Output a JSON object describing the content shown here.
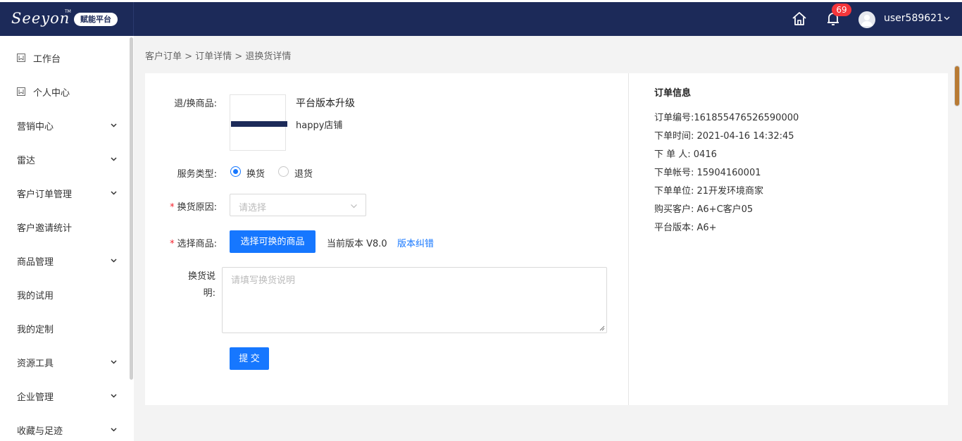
{
  "header": {
    "logo": "Seeyon",
    "logo_tm": "TM",
    "platform_badge": "赋能平台",
    "notification_count": "69",
    "username": "user589621",
    "icons": [
      "home-icon",
      "bell-icon",
      "avatar",
      "chevron-down-icon"
    ],
    "colors": {
      "topbar": "#1c2a59",
      "badge": "#f5363b",
      "primary": "#1677ff"
    }
  },
  "sidebar": {
    "items": [
      {
        "label": "工作台",
        "icon": "bookmark-icon",
        "has_children": false
      },
      {
        "label": "个人中心",
        "icon": "bookmark-icon",
        "has_children": false
      },
      {
        "label": "营销中心",
        "has_children": true
      },
      {
        "label": "雷达",
        "has_children": true
      },
      {
        "label": "客户订单管理",
        "has_children": true
      },
      {
        "label": "客户邀请统计",
        "has_children": false
      },
      {
        "label": "商品管理",
        "has_children": true
      },
      {
        "label": "我的试用",
        "has_children": false
      },
      {
        "label": "我的定制",
        "has_children": false
      },
      {
        "label": "资源工具",
        "has_children": true
      },
      {
        "label": "企业管理",
        "has_children": true
      },
      {
        "label": "收藏与足迹",
        "has_children": true
      }
    ]
  },
  "breadcrumb": "客户订单 > 订单详情 > 退换货详情",
  "form": {
    "product_label": "退/换商品:",
    "product_name": "平台版本升级",
    "product_shop": "happy店铺",
    "service_type_label": "服务类型:",
    "service_options": [
      "换货",
      "退货"
    ],
    "service_selected": "换货",
    "reason_label": "换货原因:",
    "reason_placeholder": "请选择",
    "select_product_label": "选择商品:",
    "select_product_button": "选择可换的商品",
    "current_version": "当前版本 V8.0",
    "version_fix_link": "版本纠错",
    "desc_label_line1": "换货说",
    "desc_label_line2": "明:",
    "desc_placeholder": "请填写换货说明",
    "submit_button": "提 交",
    "required_mark": "*"
  },
  "order_info": {
    "title": "订单信息",
    "rows": [
      "订单编号:161855476526590000",
      "下单时间:  2021-04-16 14:32:45",
      "下 单 人:  0416",
      "下单帐号:  15904160001",
      "下单单位:  21开发环境商家",
      "购买客户:  A6+C客户05",
      "平台版本:  A6+"
    ]
  }
}
